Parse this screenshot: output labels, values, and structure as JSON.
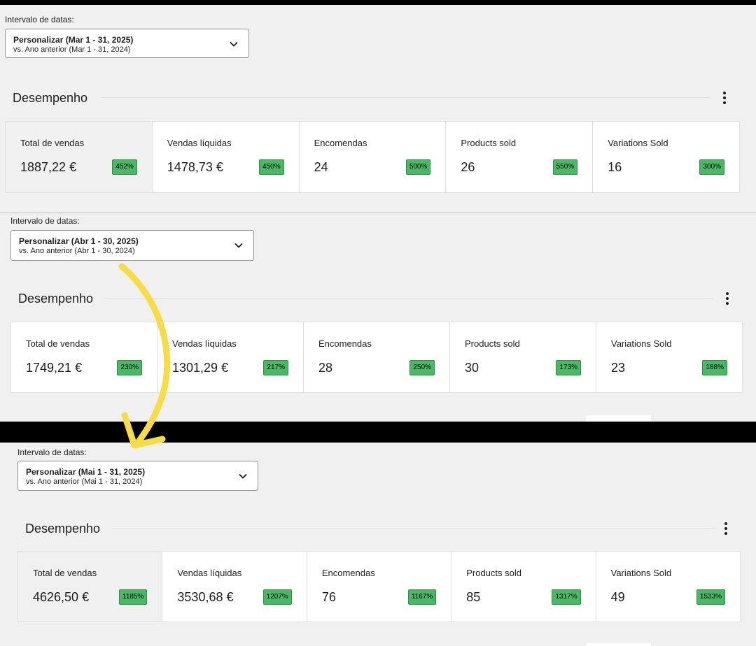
{
  "panels": [
    {
      "date_range": {
        "label": "Intervalo de datas:",
        "selected": "Personalizar (Mar 1 - 31, 2025)",
        "compare": "vs. Ano anterior (Mar 1 - 31, 2024)"
      },
      "section_title": "Desempenho",
      "cards": [
        {
          "label": "Total de vendas",
          "value": "1887,22 €",
          "change": "452%"
        },
        {
          "label": "Vendas líquidas",
          "value": "1478,73 €",
          "change": "450%"
        },
        {
          "label": "Encomendas",
          "value": "24",
          "change": "500%"
        },
        {
          "label": "Products sold",
          "value": "26",
          "change": "550%"
        },
        {
          "label": "Variations Sold",
          "value": "16",
          "change": "300%"
        }
      ]
    },
    {
      "date_range": {
        "label": "Intervalo de datas:",
        "selected": "Personalizar (Abr 1 - 30, 2025)",
        "compare": "vs. Ano anterior (Abr 1 - 30, 2024)"
      },
      "section_title": "Desempenho",
      "cards": [
        {
          "label": "Total de vendas",
          "value": "1749,21 €",
          "change": "230%"
        },
        {
          "label": "Vendas líquidas",
          "value": "1301,29 €",
          "change": "217%"
        },
        {
          "label": "Encomendas",
          "value": "28",
          "change": "250%"
        },
        {
          "label": "Products sold",
          "value": "30",
          "change": "173%"
        },
        {
          "label": "Variations Sold",
          "value": "23",
          "change": "188%"
        }
      ]
    },
    {
      "date_range": {
        "label": "Intervalo de datas:",
        "selected": "Personalizar (Mai 1 - 31, 2025)",
        "compare": "vs. Ano anterior (Mai 1 - 31, 2024)"
      },
      "section_title": "Desempenho",
      "cards": [
        {
          "label": "Total de vendas",
          "value": "4626,50 €",
          "change": "1185%"
        },
        {
          "label": "Vendas líquidas",
          "value": "3530,68 €",
          "change": "1207%"
        },
        {
          "label": "Encomendas",
          "value": "76",
          "change": "1167%"
        },
        {
          "label": "Products sold",
          "value": "85",
          "change": "1317%"
        },
        {
          "label": "Variations Sold",
          "value": "49",
          "change": "1533%"
        }
      ]
    }
  ],
  "colors": {
    "badge_positive": "#4ab866",
    "annotation_arrow": "#f7dc4a"
  },
  "icons": {
    "dropdown": "chevron-down-icon",
    "menu": "kebab-menu-icon"
  }
}
